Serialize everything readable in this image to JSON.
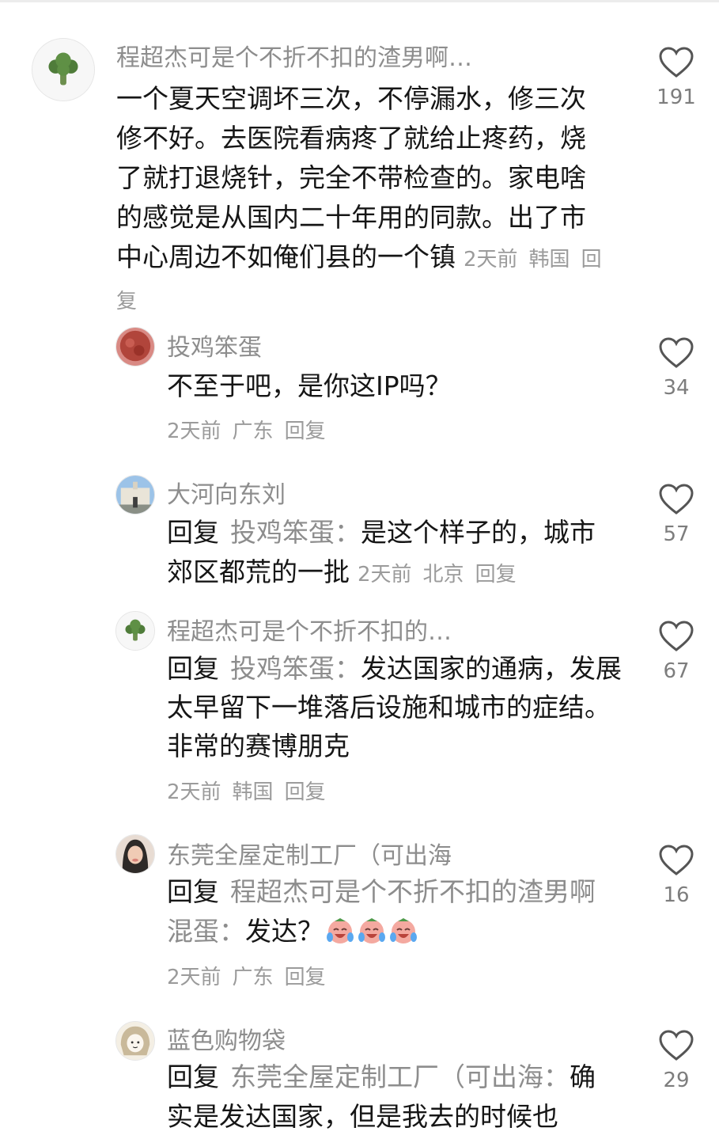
{
  "comments": [
    {
      "author": "程超杰可是个不折不扣的渣男啊…",
      "text": "一个夏天空调坏三次，不停漏水，修三次修不好。去医院看病疼了就给止疼药，烧了就打退烧针，完全不带检查的。家电啥的感觉是从国内二十年用的同款。出了市中心周边不如俺们县的一个镇",
      "time": "2天前",
      "location": "韩国",
      "reply_label": "回复",
      "likes": "191",
      "avatar_icon": "broccoli-icon"
    },
    {
      "author": "投鸡笨蛋",
      "text": "不至于吧，是你这IP吗？",
      "time": "2天前",
      "location": "广东",
      "reply_label": "回复",
      "likes": "34",
      "avatar_icon": "red-round-avatar"
    },
    {
      "author": "大河向东刘",
      "reply_prefix": "回复",
      "reply_to": "投鸡笨蛋：",
      "text": "是这个样子的，城市郊区都荒的一批",
      "time": "2天前",
      "location": "北京",
      "reply_label": "回复",
      "likes": "57",
      "avatar_icon": "building-photo-avatar"
    },
    {
      "author": "程超杰可是个不折不扣的…",
      "reply_prefix": "回复",
      "reply_to": "投鸡笨蛋：",
      "text": "发达国家的通病，发展太早留下一堆落后设施和城市的症结。非常的赛博朋克",
      "time": "2天前",
      "location": "韩国",
      "reply_label": "回复",
      "likes": "67",
      "avatar_icon": "broccoli-icon"
    },
    {
      "author": "东莞全屋定制工厂（可出海",
      "reply_prefix": "回复",
      "reply_to": "程超杰可是个不折不扣的渣男啊混蛋：",
      "text": "发达？",
      "emoji_names": [
        "crying-laughing-emoji",
        "crying-laughing-emoji",
        "crying-laughing-emoji"
      ],
      "time": "2天前",
      "location": "广东",
      "reply_label": "回复",
      "likes": "16",
      "avatar_icon": "woman-photo-avatar"
    },
    {
      "author": "蓝色购物袋",
      "reply_prefix": "回复",
      "reply_to": "东莞全屋定制工厂（可出海：",
      "text": "确实是发达国家，但是我去的时候也",
      "likes": "29",
      "avatar_icon": "cartoon-girl-avatar"
    }
  ],
  "colors": {
    "text": "#161616",
    "muted": "#8d8d8d",
    "meta": "#9b9b9b",
    "icon": "#555555"
  },
  "like_icon": "heart-outline-icon"
}
